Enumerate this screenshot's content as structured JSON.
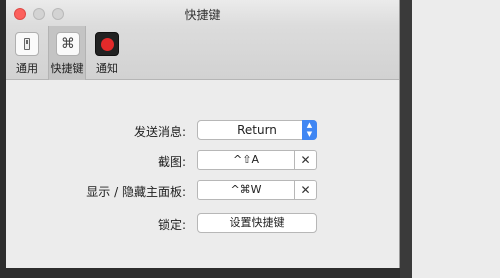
{
  "window": {
    "title": "快捷键"
  },
  "toolbar": {
    "items": [
      {
        "label": "通用",
        "icon": "switch-icon"
      },
      {
        "label": "快捷键",
        "icon": "command-key-icon",
        "glyph": "⌘",
        "active": true
      },
      {
        "label": "通知",
        "icon": "record-icon"
      }
    ]
  },
  "settings": {
    "send_message": {
      "label": "发送消息:",
      "value": "Return"
    },
    "screenshot": {
      "label": "截图:",
      "value": "^⇧A",
      "clear": "✕"
    },
    "toggle_panel": {
      "label": "显示 / 隐藏主面板:",
      "value": "^⌘W",
      "clear": "✕"
    },
    "lock": {
      "label": "锁定:",
      "button": "设置快捷键"
    }
  },
  "colors": {
    "close": "#fc605c",
    "accent": "#3f86f3",
    "record": "#e32a2a"
  }
}
